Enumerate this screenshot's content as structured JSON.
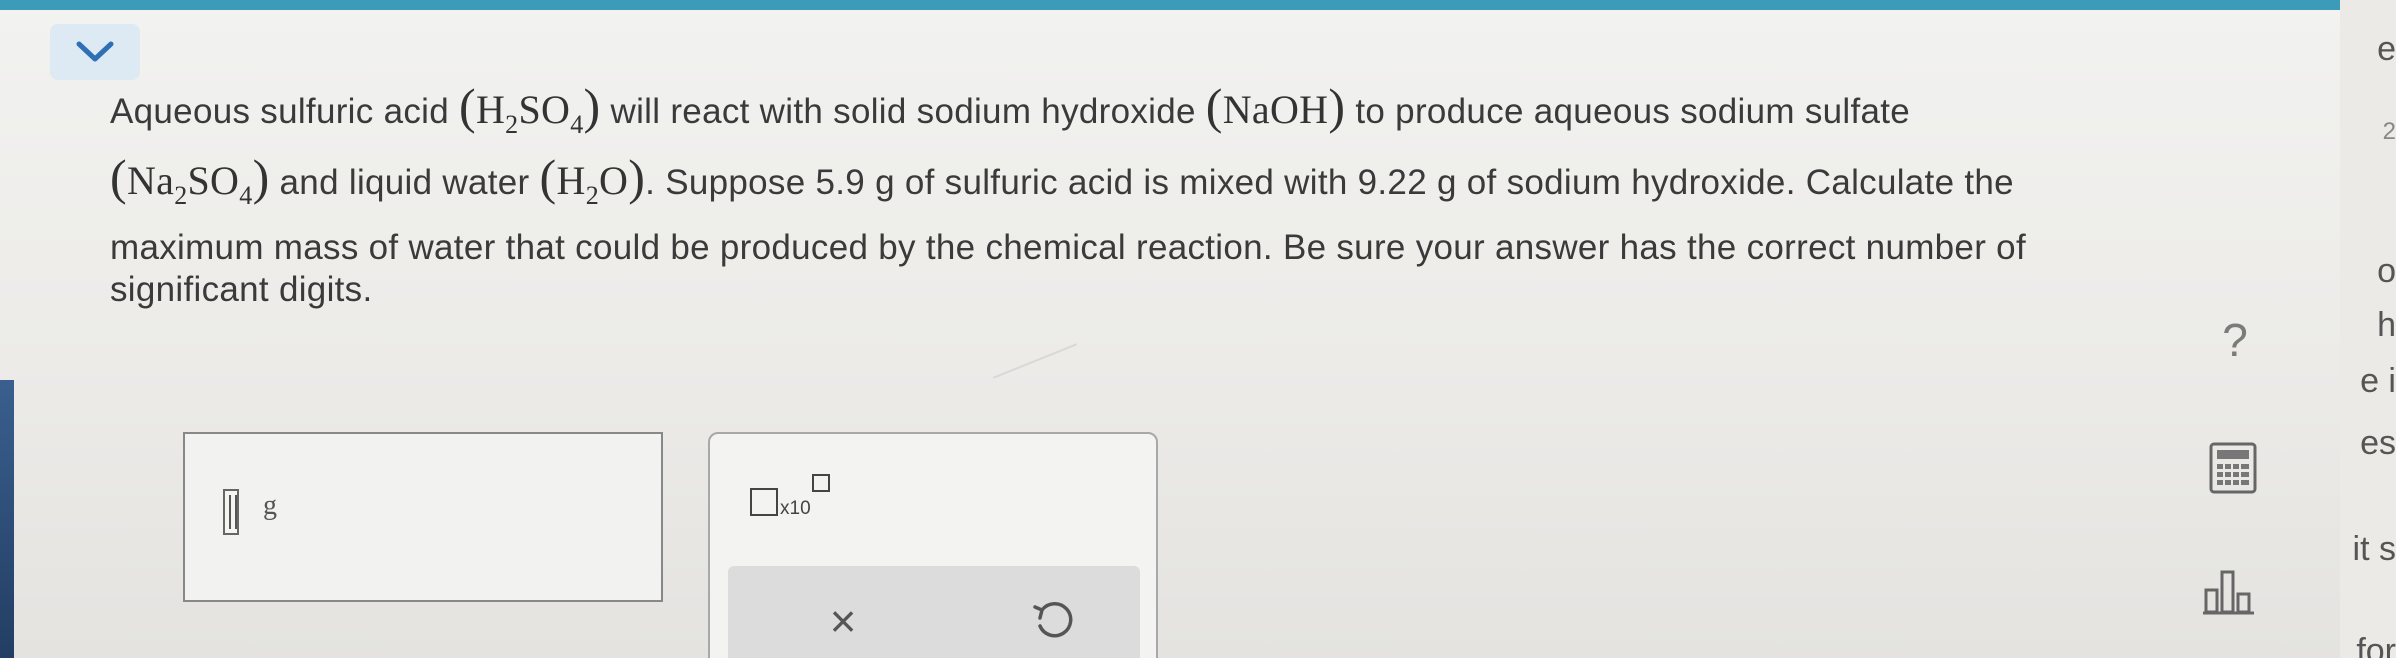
{
  "problem": {
    "line1_a": "Aqueous sulfuric acid",
    "line1_b": "will react with solid sodium hydroxide",
    "line1_c": "to produce aqueous sodium sulfate",
    "line2_b": "and liquid water",
    "line2_c": ". Suppose 5.9 g of sulfuric acid is mixed with 9.22 g of sodium hydroxide. Calculate the",
    "line3": "maximum mass of water that could be produced by the chemical reaction. Be sure your answer has the correct number of",
    "line4": "significant digits.",
    "formulas": {
      "h2so4": {
        "h": "H",
        "h_sub": "2",
        "so": "SO",
        "so_sub": "4"
      },
      "naoh": "NaOH",
      "na2so4": {
        "na": "Na",
        "na_sub": "2",
        "so": "SO",
        "so_sub": "4"
      },
      "h2o": {
        "h": "H",
        "h_sub": "2",
        "o": "O"
      }
    }
  },
  "answer": {
    "value": "",
    "unit": "g"
  },
  "keypad": {
    "sci_notation_label": "x10",
    "clear_symbol": "×"
  },
  "side_buttons": {
    "help_symbol": "?"
  },
  "right_panel_fragments": [
    "e",
    "2",
    "o",
    "h",
    "e i",
    "es",
    "it s",
    "for"
  ],
  "colors": {
    "top_band": "#3c9bb8",
    "collapse_button_bg": "#dde9f3",
    "chevron": "#2f6fb5"
  },
  "icons": [
    "chevron-down-icon",
    "help-icon",
    "calculator-icon",
    "bar-chart-icon",
    "clear-icon",
    "undo-icon"
  ]
}
